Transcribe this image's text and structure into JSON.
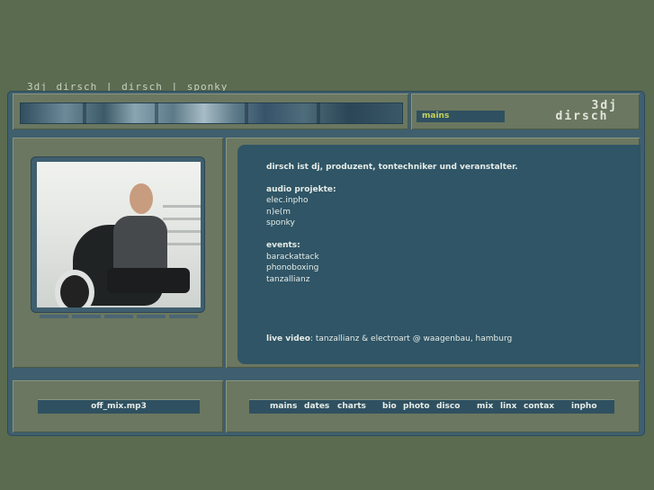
{
  "top_links": {
    "line": "3dj dirsch  |  dirsch  |  sponky"
  },
  "header": {
    "section_tab": "mains",
    "logo_line1": "3dj",
    "logo_line2": "dirsch"
  },
  "content": {
    "intro": "dirsch ist dj, produzent, tontechniker und veranstalter.",
    "audio_heading": "audio projekte:",
    "audio_items": [
      "elec.inpho",
      "n)e(m",
      "sponky"
    ],
    "events_heading": "events:",
    "event_items": [
      "barackattack",
      "phonoboxing",
      "tanzallianz"
    ],
    "live_label": "live video",
    "live_text": ": tanzallianz & electroart @ waagenbau, hamburg"
  },
  "player": {
    "label": "off_mix.mp3"
  },
  "nav": {
    "items": [
      "mains",
      "dates",
      "charts",
      "bio",
      "photo",
      "disco",
      "mix",
      "linx",
      "contax",
      "inpho"
    ]
  },
  "colors": {
    "background": "#5a6b50",
    "frame": "#3f5f6f",
    "panel": "#6b7760",
    "accent": "#c7d35a"
  }
}
